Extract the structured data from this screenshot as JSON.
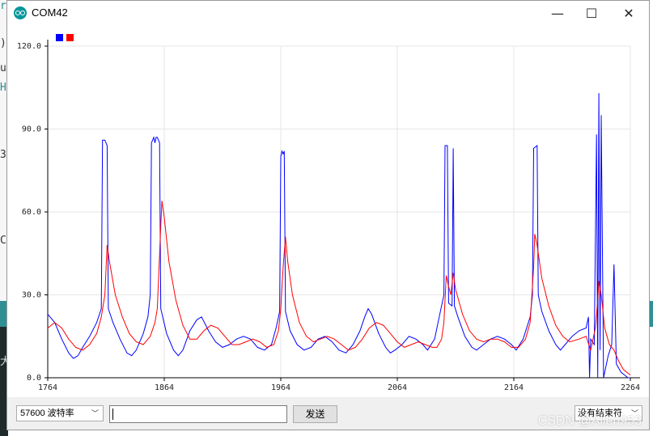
{
  "background": {
    "chars": [
      "r",
      ")",
      "u",
      "H",
      "3",
      "C",
      "大"
    ]
  },
  "window": {
    "title": "COM42",
    "icon": "arduino-icon",
    "controls": {
      "minimize": "—",
      "maximize": "☐",
      "close": "✕"
    }
  },
  "chart_data": {
    "type": "line",
    "legend_colors": [
      "#0000ff",
      "#ff0000"
    ],
    "xlim": [
      1764,
      2264
    ],
    "ylim": [
      0,
      120
    ],
    "xticks": [
      "1764",
      "1864",
      "1964",
      "2064",
      "2164",
      "2264"
    ],
    "yticks": [
      "0.0",
      "30.0",
      "60.0",
      "90.0",
      "120.0"
    ],
    "grid": true,
    "legend": "top-left",
    "series": [
      {
        "color": "#0000ff",
        "points": [
          [
            1764,
            23
          ],
          [
            1770,
            20
          ],
          [
            1776,
            14
          ],
          [
            1782,
            9
          ],
          [
            1786,
            7
          ],
          [
            1790,
            8
          ],
          [
            1794,
            11
          ],
          [
            1800,
            15
          ],
          [
            1806,
            20
          ],
          [
            1810,
            25
          ],
          [
            1811,
            86
          ],
          [
            1813,
            86
          ],
          [
            1815,
            84
          ],
          [
            1816,
            25
          ],
          [
            1820,
            20
          ],
          [
            1826,
            14
          ],
          [
            1832,
            9
          ],
          [
            1836,
            8
          ],
          [
            1840,
            10
          ],
          [
            1846,
            16
          ],
          [
            1850,
            22
          ],
          [
            1852,
            30
          ],
          [
            1853,
            85
          ],
          [
            1855,
            87
          ],
          [
            1856,
            85
          ],
          [
            1857,
            87
          ],
          [
            1858,
            87
          ],
          [
            1860,
            85
          ],
          [
            1861,
            25
          ],
          [
            1866,
            16
          ],
          [
            1872,
            10
          ],
          [
            1876,
            8
          ],
          [
            1880,
            10
          ],
          [
            1886,
            17
          ],
          [
            1892,
            21
          ],
          [
            1896,
            22
          ],
          [
            1902,
            17
          ],
          [
            1908,
            13
          ],
          [
            1914,
            11
          ],
          [
            1920,
            12
          ],
          [
            1926,
            14
          ],
          [
            1932,
            15
          ],
          [
            1938,
            14
          ],
          [
            1944,
            11
          ],
          [
            1950,
            10
          ],
          [
            1956,
            12
          ],
          [
            1960,
            18
          ],
          [
            1963,
            24
          ],
          [
            1964,
            80
          ],
          [
            1965,
            82
          ],
          [
            1966,
            81
          ],
          [
            1967,
            82
          ],
          [
            1968,
            24
          ],
          [
            1972,
            17
          ],
          [
            1978,
            12
          ],
          [
            1984,
            10
          ],
          [
            1990,
            11
          ],
          [
            1996,
            14
          ],
          [
            2002,
            15
          ],
          [
            2008,
            13
          ],
          [
            2014,
            10
          ],
          [
            2020,
            9
          ],
          [
            2026,
            12
          ],
          [
            2032,
            17
          ],
          [
            2036,
            22
          ],
          [
            2039,
            25
          ],
          [
            2042,
            23
          ],
          [
            2048,
            16
          ],
          [
            2054,
            11
          ],
          [
            2058,
            9
          ],
          [
            2062,
            10
          ],
          [
            2068,
            12
          ],
          [
            2074,
            15
          ],
          [
            2080,
            14
          ],
          [
            2086,
            12
          ],
          [
            2090,
            10
          ],
          [
            2096,
            14
          ],
          [
            2100,
            22
          ],
          [
            2104,
            30
          ],
          [
            2105,
            84
          ],
          [
            2107,
            84
          ],
          [
            2108,
            27
          ],
          [
            2111,
            26
          ],
          [
            2112,
            83
          ],
          [
            2113,
            26
          ],
          [
            2116,
            22
          ],
          [
            2122,
            15
          ],
          [
            2128,
            11
          ],
          [
            2132,
            10
          ],
          [
            2138,
            12
          ],
          [
            2144,
            14
          ],
          [
            2150,
            15
          ],
          [
            2156,
            14
          ],
          [
            2162,
            12
          ],
          [
            2166,
            10
          ],
          [
            2172,
            14
          ],
          [
            2178,
            22
          ],
          [
            2180,
            30
          ],
          [
            2181,
            83
          ],
          [
            2184,
            84
          ],
          [
            2185,
            30
          ],
          [
            2188,
            24
          ],
          [
            2194,
            17
          ],
          [
            2200,
            12
          ],
          [
            2204,
            10
          ],
          [
            2208,
            12
          ],
          [
            2214,
            15
          ],
          [
            2220,
            17
          ],
          [
            2226,
            18
          ],
          [
            2228,
            22
          ],
          [
            2229,
            0
          ],
          [
            2230,
            14
          ],
          [
            2233,
            12
          ],
          [
            2235,
            88
          ],
          [
            2236,
            0
          ],
          [
            2237,
            103
          ],
          [
            2238,
            10
          ],
          [
            2239,
            95
          ],
          [
            2241,
            0
          ],
          [
            2245,
            8
          ],
          [
            2248,
            12
          ],
          [
            2250,
            41
          ],
          [
            2252,
            5
          ],
          [
            2256,
            2
          ],
          [
            2262,
            0
          ],
          [
            2264,
            0
          ]
        ]
      },
      {
        "color": "#ff0000",
        "points": [
          [
            1764,
            18
          ],
          [
            1770,
            20
          ],
          [
            1776,
            18
          ],
          [
            1782,
            14
          ],
          [
            1788,
            11
          ],
          [
            1794,
            10
          ],
          [
            1800,
            12
          ],
          [
            1806,
            16
          ],
          [
            1810,
            22
          ],
          [
            1813,
            30
          ],
          [
            1815,
            48
          ],
          [
            1817,
            42
          ],
          [
            1822,
            30
          ],
          [
            1828,
            22
          ],
          [
            1834,
            16
          ],
          [
            1840,
            13
          ],
          [
            1846,
            12
          ],
          [
            1852,
            15
          ],
          [
            1856,
            20
          ],
          [
            1858,
            25
          ],
          [
            1861,
            55
          ],
          [
            1862,
            64
          ],
          [
            1864,
            58
          ],
          [
            1868,
            42
          ],
          [
            1874,
            28
          ],
          [
            1880,
            19
          ],
          [
            1886,
            14
          ],
          [
            1892,
            14
          ],
          [
            1898,
            17
          ],
          [
            1904,
            19
          ],
          [
            1910,
            18
          ],
          [
            1916,
            15
          ],
          [
            1922,
            12
          ],
          [
            1928,
            12
          ],
          [
            1934,
            13
          ],
          [
            1940,
            14
          ],
          [
            1946,
            13
          ],
          [
            1952,
            11
          ],
          [
            1958,
            12
          ],
          [
            1962,
            17
          ],
          [
            1964,
            25
          ],
          [
            1966,
            40
          ],
          [
            1968,
            51
          ],
          [
            1970,
            42
          ],
          [
            1974,
            30
          ],
          [
            1980,
            20
          ],
          [
            1986,
            15
          ],
          [
            1992,
            13
          ],
          [
            1998,
            14
          ],
          [
            2004,
            15
          ],
          [
            2010,
            14
          ],
          [
            2016,
            12
          ],
          [
            2022,
            10
          ],
          [
            2028,
            11
          ],
          [
            2034,
            14
          ],
          [
            2040,
            18
          ],
          [
            2046,
            20
          ],
          [
            2052,
            19
          ],
          [
            2058,
            16
          ],
          [
            2064,
            13
          ],
          [
            2070,
            11
          ],
          [
            2076,
            12
          ],
          [
            2082,
            13
          ],
          [
            2088,
            12
          ],
          [
            2094,
            11
          ],
          [
            2098,
            11
          ],
          [
            2102,
            14
          ],
          [
            2104,
            20
          ],
          [
            2106,
            37
          ],
          [
            2108,
            33
          ],
          [
            2110,
            30
          ],
          [
            2112,
            38
          ],
          [
            2114,
            32
          ],
          [
            2120,
            23
          ],
          [
            2126,
            17
          ],
          [
            2132,
            14
          ],
          [
            2138,
            13
          ],
          [
            2144,
            14
          ],
          [
            2150,
            14
          ],
          [
            2156,
            13
          ],
          [
            2162,
            11
          ],
          [
            2168,
            11
          ],
          [
            2174,
            14
          ],
          [
            2178,
            20
          ],
          [
            2181,
            40
          ],
          [
            2182,
            52
          ],
          [
            2184,
            48
          ],
          [
            2188,
            36
          ],
          [
            2194,
            26
          ],
          [
            2200,
            19
          ],
          [
            2206,
            15
          ],
          [
            2212,
            13
          ],
          [
            2220,
            14
          ],
          [
            2226,
            15
          ],
          [
            2230,
            10
          ],
          [
            2234,
            18
          ],
          [
            2236,
            28
          ],
          [
            2237,
            35
          ],
          [
            2239,
            30
          ],
          [
            2242,
            18
          ],
          [
            2246,
            12
          ],
          [
            2250,
            10
          ],
          [
            2254,
            6
          ],
          [
            2258,
            3
          ],
          [
            2264,
            1
          ]
        ]
      }
    ]
  },
  "bottom_bar": {
    "baud_rate": "57600 波特率",
    "input_value": "",
    "send_label": "发送",
    "line_ending": "没有结束符"
  },
  "watermark": "CSDN @Allen953"
}
